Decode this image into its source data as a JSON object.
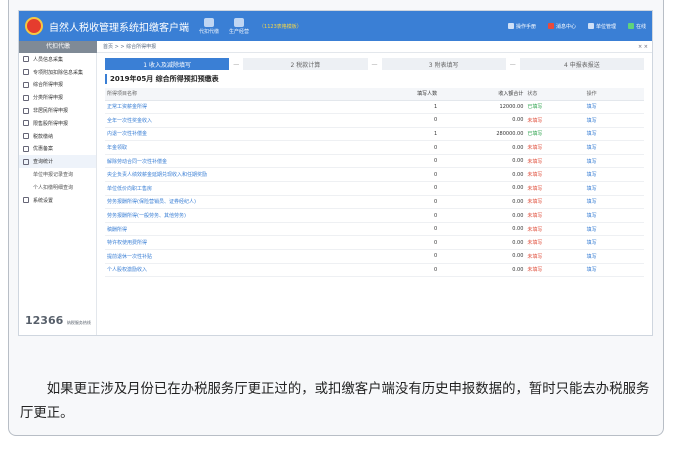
{
  "app": {
    "title": "自然人税收管理系统扣缴客户端",
    "subtitle": "（1123表格模板）",
    "topnav": [
      "代扣代缴",
      "生产经营"
    ],
    "topright": [
      "操作手册",
      "消息中心",
      "单位管理",
      "在线"
    ]
  },
  "sidebar": {
    "header": "代扣代缴",
    "items": [
      {
        "label": "人员信息采集",
        "kind": "item"
      },
      {
        "label": "专项附加扣除信息采集",
        "kind": "item"
      },
      {
        "label": "综合所得申报",
        "kind": "item"
      },
      {
        "label": "分类所得申报",
        "kind": "item"
      },
      {
        "label": "非居民所得申报",
        "kind": "item"
      },
      {
        "label": "限售股所得申报",
        "kind": "item"
      },
      {
        "label": "税款缴纳",
        "kind": "item"
      },
      {
        "label": "优惠备案",
        "kind": "item"
      },
      {
        "label": "查询统计",
        "kind": "item-open"
      },
      {
        "label": "单位申报记录查询",
        "kind": "sub"
      },
      {
        "label": "个人扣缴明细查询",
        "kind": "sub"
      },
      {
        "label": "系统设置",
        "kind": "item"
      }
    ],
    "hotline_label": "纳税服务热线",
    "hotline": "12366"
  },
  "breadcrumb": "首页 > > 综合所得申报",
  "tab_close": "× ×",
  "steps": [
    "1 收入及减除填写",
    "2 税款计算",
    "3 附表填写",
    "4 申报表报送"
  ],
  "step_separator": "—",
  "period_title": "2019年05月  综合所得预扣预缴表",
  "table": {
    "columns": [
      "所得项目名称",
      "填写人数",
      "收入额合计",
      "状态",
      "操作"
    ],
    "rows": [
      {
        "name": "正常工资薪金所得",
        "count": "1",
        "amount": "12000.00",
        "status": "已填写",
        "action": "填写"
      },
      {
        "name": "全年一次性奖金收入",
        "count": "0",
        "amount": "0.00",
        "status": "未填写",
        "action": "填写"
      },
      {
        "name": "内退一次性补偿金",
        "count": "1",
        "amount": "280000.00",
        "status": "已填写",
        "action": "填写"
      },
      {
        "name": "年金领取",
        "count": "0",
        "amount": "0.00",
        "status": "未填写",
        "action": "填写"
      },
      {
        "name": "解除劳动合同一次性补偿金",
        "count": "0",
        "amount": "0.00",
        "status": "未填写",
        "action": "填写"
      },
      {
        "name": "央企负责人绩效薪金延期兑现收入和任期奖励",
        "count": "0",
        "amount": "0.00",
        "status": "未填写",
        "action": "填写"
      },
      {
        "name": "单位低价向职工售房",
        "count": "0",
        "amount": "0.00",
        "status": "未填写",
        "action": "填写"
      },
      {
        "name": "劳务报酬所得(保险营销员、证券经纪人)",
        "count": "0",
        "amount": "0.00",
        "status": "未填写",
        "action": "填写"
      },
      {
        "name": "劳务报酬所得(一般劳务、其他劳务)",
        "count": "0",
        "amount": "0.00",
        "status": "未填写",
        "action": "填写"
      },
      {
        "name": "稿酬所得",
        "count": "0",
        "amount": "0.00",
        "status": "未填写",
        "action": "填写"
      },
      {
        "name": "特许权使用费所得",
        "count": "0",
        "amount": "0.00",
        "status": "未填写",
        "action": "填写"
      },
      {
        "name": "提前退休一次性补贴",
        "count": "0",
        "amount": "0.00",
        "status": "未填写",
        "action": "填写"
      },
      {
        "name": "个人股权激励收入",
        "count": "0",
        "amount": "0.00",
        "status": "未填写",
        "action": "填写"
      }
    ]
  },
  "paragraph": "如果更正涉及月份已在办税服务厅更正过的，或扣缴客户端没有历史申报数据的，暂时只能去办税服务厅更正。",
  "colors": {
    "brand": "#3a7fd5",
    "filled": "#2fa44f",
    "unfilled": "#e0513f"
  }
}
